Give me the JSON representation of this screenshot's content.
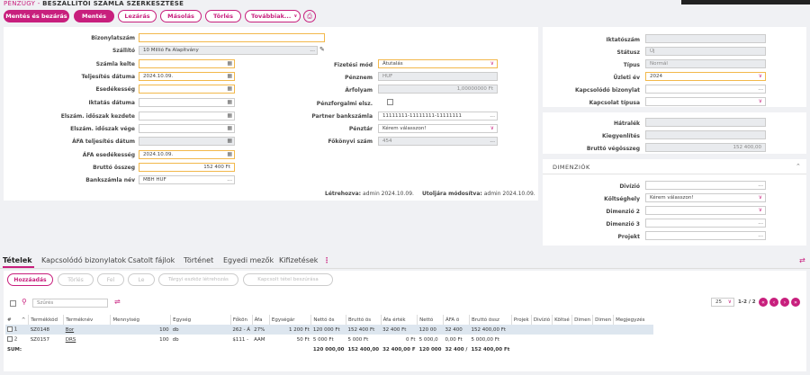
{
  "breadcrumb": {
    "module": "PÉNZÜGY",
    "sep": " - ",
    "page": "BESZÁLLÍTÓI SZÁMLA SZERKESZTÉSE"
  },
  "toolbar": {
    "save_close": "Mentés és bezárás",
    "save": "Mentés",
    "lock": "Lezárás",
    "copy": "Másolás",
    "delete": "Törlés",
    "more": "Továbbiak...",
    "more_chevron": "∨"
  },
  "form": {
    "bizonylatszam": {
      "label": "Bizonylatszám",
      "value": ""
    },
    "szallito": {
      "label": "Szállító",
      "value": "10 Millió Fa Alapítvány"
    },
    "szamla_kelte": {
      "label": "Számla kelte",
      "value": ""
    },
    "teljesites_datuma": {
      "label": "Teljesítés dátuma",
      "value": "2024.10.09."
    },
    "esedekesseg": {
      "label": "Esedékesség",
      "value": ""
    },
    "iktatas_datuma": {
      "label": "Iktatás dátuma",
      "value": ""
    },
    "elszam_kezdete": {
      "label": "Elszám. időszak kezdete",
      "value": ""
    },
    "elszam_vege": {
      "label": "Elszám. időszak vége",
      "value": ""
    },
    "afa_teljesites": {
      "label": "ÁFA teljesítés dátum",
      "value": ""
    },
    "afa_esedekesseg": {
      "label": "ÁFA esedékesség",
      "value": "2024.10.09."
    },
    "brutto_osszeg": {
      "label": "Bruttó összeg",
      "value": "152 400 Ft"
    },
    "bankszamla_nev": {
      "label": "Bankszámla név",
      "value": "MBH HUF"
    },
    "fizetesi_mod": {
      "label": "Fizetési mód",
      "value": "Átutalás"
    },
    "penznem": {
      "label": "Pénznem",
      "value": "HUF"
    },
    "arfolyam": {
      "label": "Árfolyam",
      "value": "1,00000000 Ft"
    },
    "penzforgalmi": {
      "label": "Pénzforgalmi elsz."
    },
    "partner_bankszamla": {
      "label": "Partner bankszámla",
      "value": "11111111-11111111-11111111"
    },
    "penztar": {
      "label": "Pénztár",
      "value": "Kérem válasszon!"
    },
    "fokonyvi_szam": {
      "label": "Főkönyvi szám",
      "value": "454"
    },
    "created_label": "Létrehozva:",
    "created_value": "admin 2024.10.09.",
    "modified_label": "Utoljára módosítva:",
    "modified_value": "admin 2024.10.09."
  },
  "right": {
    "iktatoszam": {
      "label": "Iktatószám",
      "value": ""
    },
    "statusz": {
      "label": "Státusz",
      "value": "Új"
    },
    "tipus": {
      "label": "Típus",
      "value": "Normál"
    },
    "uzleti_ev": {
      "label": "Üzleti év",
      "value": "2024"
    },
    "kapcsolodo_bizonylat": {
      "label": "Kapcsolódó bizonylat",
      "value": ""
    },
    "kapcsolat_tipusa": {
      "label": "Kapcsolat típusa",
      "value": ""
    },
    "hatralek": {
      "label": "Hátralék",
      "value": ""
    },
    "kiegyenlites": {
      "label": "Kiegyenlítés",
      "value": ""
    },
    "brutto_vegosszeg": {
      "label": "Bruttó végösszeg",
      "value": "152 400,00"
    }
  },
  "dimenziok": {
    "title": "DIMENZIÓK",
    "divizio": {
      "label": "Divízió",
      "value": ""
    },
    "koltseghely": {
      "label": "Költséghely",
      "value": "Kérem válasszon!"
    },
    "dimenzio2": {
      "label": "Dimenzió 2",
      "value": ""
    },
    "dimenzio3": {
      "label": "Dimenzió 3",
      "value": ""
    },
    "projekt": {
      "label": "Projekt",
      "value": ""
    }
  },
  "tabs": [
    "Tételek",
    "Kapcsolódó bizonylatok",
    "Csatolt fájlok",
    "Történet",
    "Egyedi mezők",
    "Kifizetések"
  ],
  "items_toolbar": {
    "add": "Hozzáadás",
    "delete": "Törlés",
    "up": "Fel",
    "down": "Le",
    "asset": "Tárgyi eszköz létrehozás",
    "link": "Kapcsolt tétel beszúrása",
    "filter_placeholder": "Szűrés",
    "page_size": "25",
    "page_info": "1-2 / 2"
  },
  "table": {
    "headers": [
      "#",
      "^",
      "Termékkód",
      "Terméknév",
      "Mennyiség",
      "Egység",
      "Főkön",
      "Áfa",
      "Egységár",
      "Nettó ös",
      "Bruttó ös",
      "Áfa érték",
      "Nettó",
      "ÁFA ö",
      "Bruttó össz",
      "Projek",
      "Divízió",
      "Költsé",
      "Dimen",
      "Dimen",
      "Megjegyzés"
    ],
    "rows": [
      [
        "1",
        "SZ0148",
        "Bor",
        "100",
        "db",
        "262 - Á",
        "27%",
        "1 200 Ft",
        "120 000 Ft",
        "152 400 Ft",
        "32 400 Ft",
        "120 00",
        "32 400",
        "152 400,00 Ft"
      ],
      [
        "2",
        "SZ0157",
        "DRS",
        "100",
        "db",
        "$111 -",
        "AAM",
        "50 Ft",
        "5 000 Ft",
        "5 000 Ft",
        "0 Ft",
        "5 000,0",
        "0,00 Ft",
        "5 000,00 Ft"
      ]
    ],
    "sum_label": "SUM:",
    "sums": [
      "120 000,00",
      "152 400,00",
      "32 400,00 F",
      "120 000",
      "32 400 /",
      "152 400,00 Ft"
    ]
  },
  "colors": {
    "accent": "#c81f7d",
    "highlight": "#f2b84b"
  }
}
